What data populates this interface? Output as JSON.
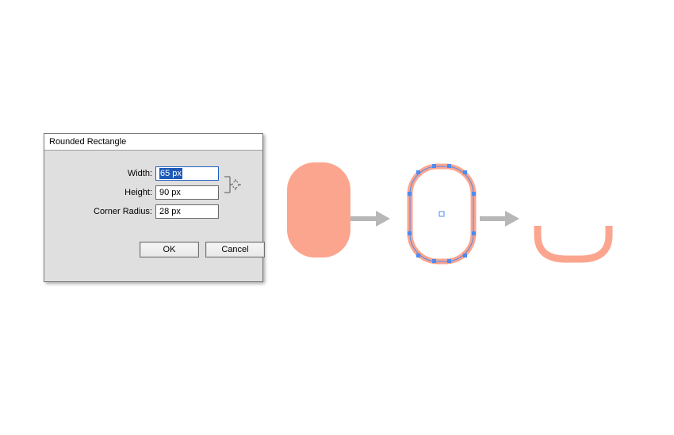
{
  "dialog": {
    "title": "Rounded Rectangle",
    "fields": {
      "width_label": "Width:",
      "width_value": "65 px",
      "height_label": "Height:",
      "height_value": "90 px",
      "radius_label": "Corner Radius:",
      "radius_value": "28 px"
    },
    "buttons": {
      "ok": "OK",
      "cancel": "Cancel"
    }
  },
  "colors": {
    "salmon": "#fba58f",
    "salmon_stroke": "#f9a38d",
    "handle": "#4b8bf4",
    "arrow": "#b7b7b7"
  }
}
